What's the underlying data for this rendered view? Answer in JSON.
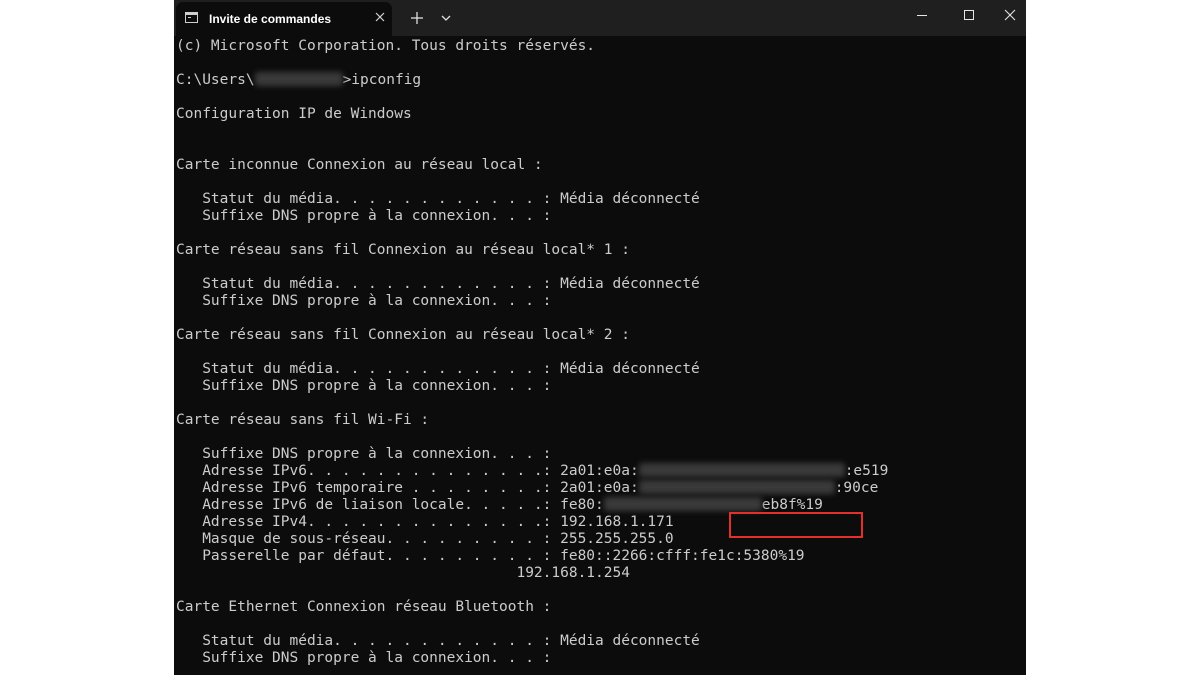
{
  "window": {
    "tab_title": "Invite de commandes",
    "tab_icon": "terminal-icon",
    "tab_close_icon": "close-icon",
    "new_tab_icon": "plus-icon",
    "dropdown_icon": "chevron-down-icon",
    "minimize_icon": "minimize-icon",
    "maximize_icon": "maximize-icon",
    "close_icon": "close-icon",
    "titlebar_color": "#1f1f1f",
    "console_background": "#0c0c0c",
    "console_text_color": "#cccccc",
    "highlight_color": "#e3302a"
  },
  "console": {
    "lines": [
      {
        "text": "(c) Microsoft Corporation. Tous droits réservés."
      },
      {
        "text": ""
      },
      {
        "text": "C:\\Users\\",
        "redacted": true,
        "after": ">ipconfig"
      },
      {
        "text": ""
      },
      {
        "text": "Configuration IP de Windows"
      },
      {
        "text": ""
      },
      {
        "text": ""
      },
      {
        "text": "Carte inconnue Connexion au réseau local :"
      },
      {
        "text": ""
      },
      {
        "text": "   Statut du média. . . . . . . . . . . . : Média déconnecté"
      },
      {
        "text": "   Suffixe DNS propre à la connexion. . . :"
      },
      {
        "text": ""
      },
      {
        "text": "Carte réseau sans fil Connexion au réseau local* 1 :"
      },
      {
        "text": ""
      },
      {
        "text": "   Statut du média. . . . . . . . . . . . : Média déconnecté"
      },
      {
        "text": "   Suffixe DNS propre à la connexion. . . :"
      },
      {
        "text": ""
      },
      {
        "text": "Carte réseau sans fil Connexion au réseau local* 2 :"
      },
      {
        "text": ""
      },
      {
        "text": "   Statut du média. . . . . . . . . . . . : Média déconnecté"
      },
      {
        "text": "   Suffixe DNS propre à la connexion. . . :"
      },
      {
        "text": ""
      },
      {
        "text": "Carte réseau sans fil Wi-Fi :"
      },
      {
        "text": ""
      },
      {
        "text": "   Suffixe DNS propre à la connexion. . . :"
      },
      {
        "text": "   Adresse IPv6. . . . . . . . . . . . . .: 2a01:e0a:",
        "redacted": true,
        "after": ":e519"
      },
      {
        "text": "   Adresse IPv6 temporaire . . . . . . . .: 2a01:e0a:",
        "redacted": true,
        "after": ":90ce"
      },
      {
        "text": "   Adresse IPv6 de liaison locale. . . . .: fe80:",
        "redacted": true,
        "after": "eb8f%19"
      },
      {
        "text": "   Adresse IPv4. . . . . . . . . . . . . .: 192.168.1.171"
      },
      {
        "text": "   Masque de sous-réseau. . . . . . . . . : 255.255.255.0"
      },
      {
        "text": "   Passerelle par défaut. . . . . . . . . : fe80::2266:cfff:fe1c:5380%19"
      },
      {
        "text": "                                       192.168.1.254"
      },
      {
        "text": ""
      },
      {
        "text": "Carte Ethernet Connexion réseau Bluetooth :"
      },
      {
        "text": ""
      },
      {
        "text": "   Statut du média. . . . . . . . . . . . : Média déconnecté"
      },
      {
        "text": "   Suffixe DNS propre à la connexion. . . :"
      }
    ]
  }
}
